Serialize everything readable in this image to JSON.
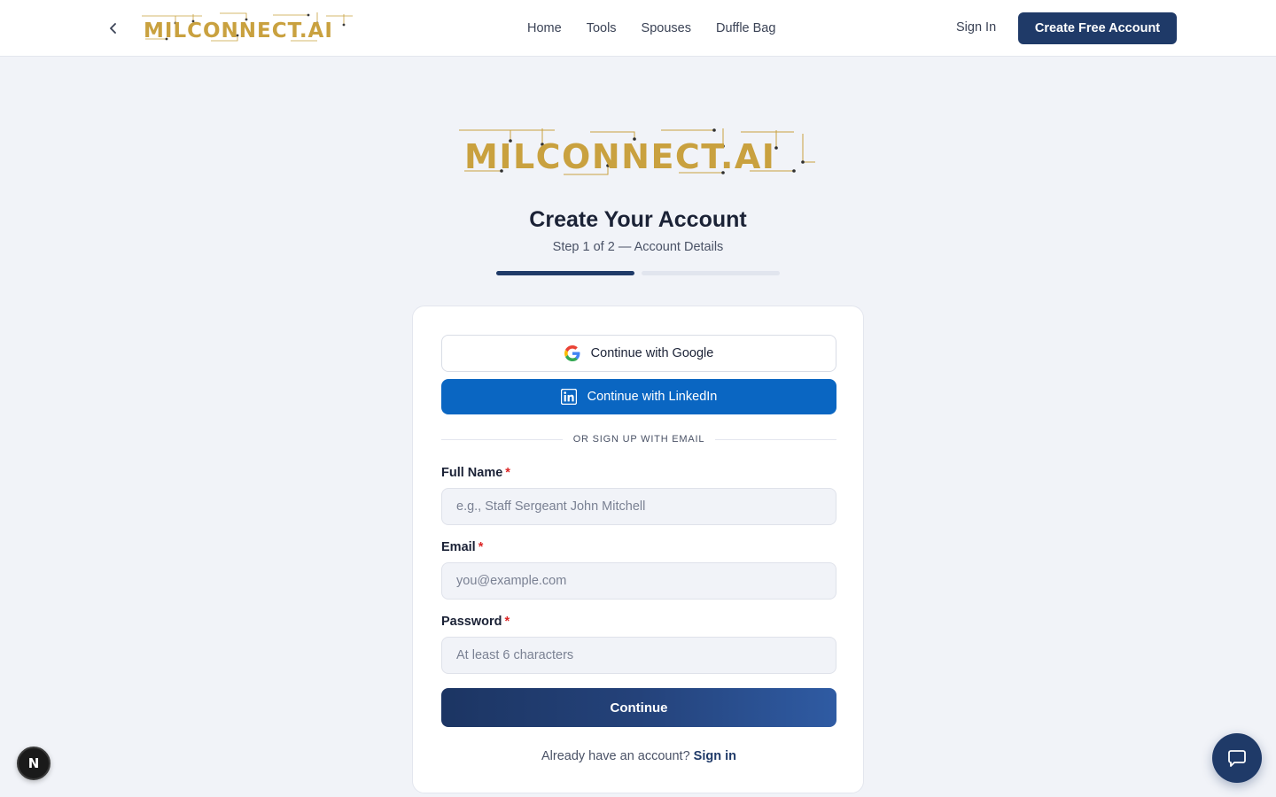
{
  "header": {
    "logo_text": "MILCONNECT.AI",
    "nav": [
      "Home",
      "Tools",
      "Spouses",
      "Duffle Bag"
    ],
    "sign_in": "Sign In",
    "create_account": "Create Free Account"
  },
  "hero": {
    "logo_text": "MILCONNECT.AI",
    "title": "Create Your Account",
    "subtitle": "Step 1 of 2 — Account Details",
    "progress": {
      "current_step": 1,
      "total_steps": 2
    }
  },
  "form": {
    "google_label": "Continue with Google",
    "linkedin_label": "Continue with LinkedIn",
    "divider": "OR SIGN UP WITH EMAIL",
    "full_name": {
      "label": "Full Name",
      "required_mark": "*",
      "placeholder": "e.g., Staff Sergeant John Mitchell",
      "value": ""
    },
    "email": {
      "label": "Email",
      "required_mark": "*",
      "placeholder": "you@example.com",
      "value": ""
    },
    "password": {
      "label": "Password",
      "required_mark": "*",
      "placeholder": "At least 6 characters",
      "value": ""
    },
    "continue_label": "Continue",
    "already_text": "Already have an account?",
    "sign_in_link": "Sign in"
  },
  "floating": {
    "dev_badge_letter": "N"
  },
  "colors": {
    "brand_navy": "#1f3a68",
    "linkedin_blue": "#0a66c2",
    "logo_gold": "#c9a13f",
    "required_red": "#dc2626",
    "page_bg": "#f1f3f8"
  }
}
